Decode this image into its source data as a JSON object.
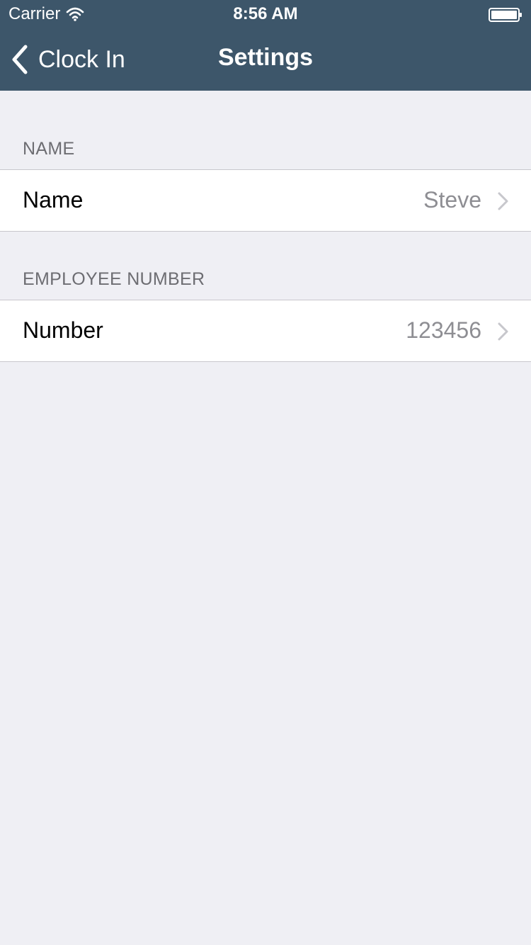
{
  "status_bar": {
    "carrier": "Carrier",
    "time": "8:56 AM"
  },
  "nav": {
    "back_label": "Clock In",
    "title": "Settings",
    "bar_color": "#3d566a"
  },
  "sections": {
    "name": {
      "header": "NAME",
      "row_label": "Name",
      "row_value": "Steve"
    },
    "employee_number": {
      "header": "EMPLOYEE NUMBER",
      "row_label": "Number",
      "row_value": "123456"
    }
  },
  "icons": [
    "wifi-icon",
    "battery-icon",
    "back-chevron-icon",
    "disclosure-chevron-icon"
  ]
}
